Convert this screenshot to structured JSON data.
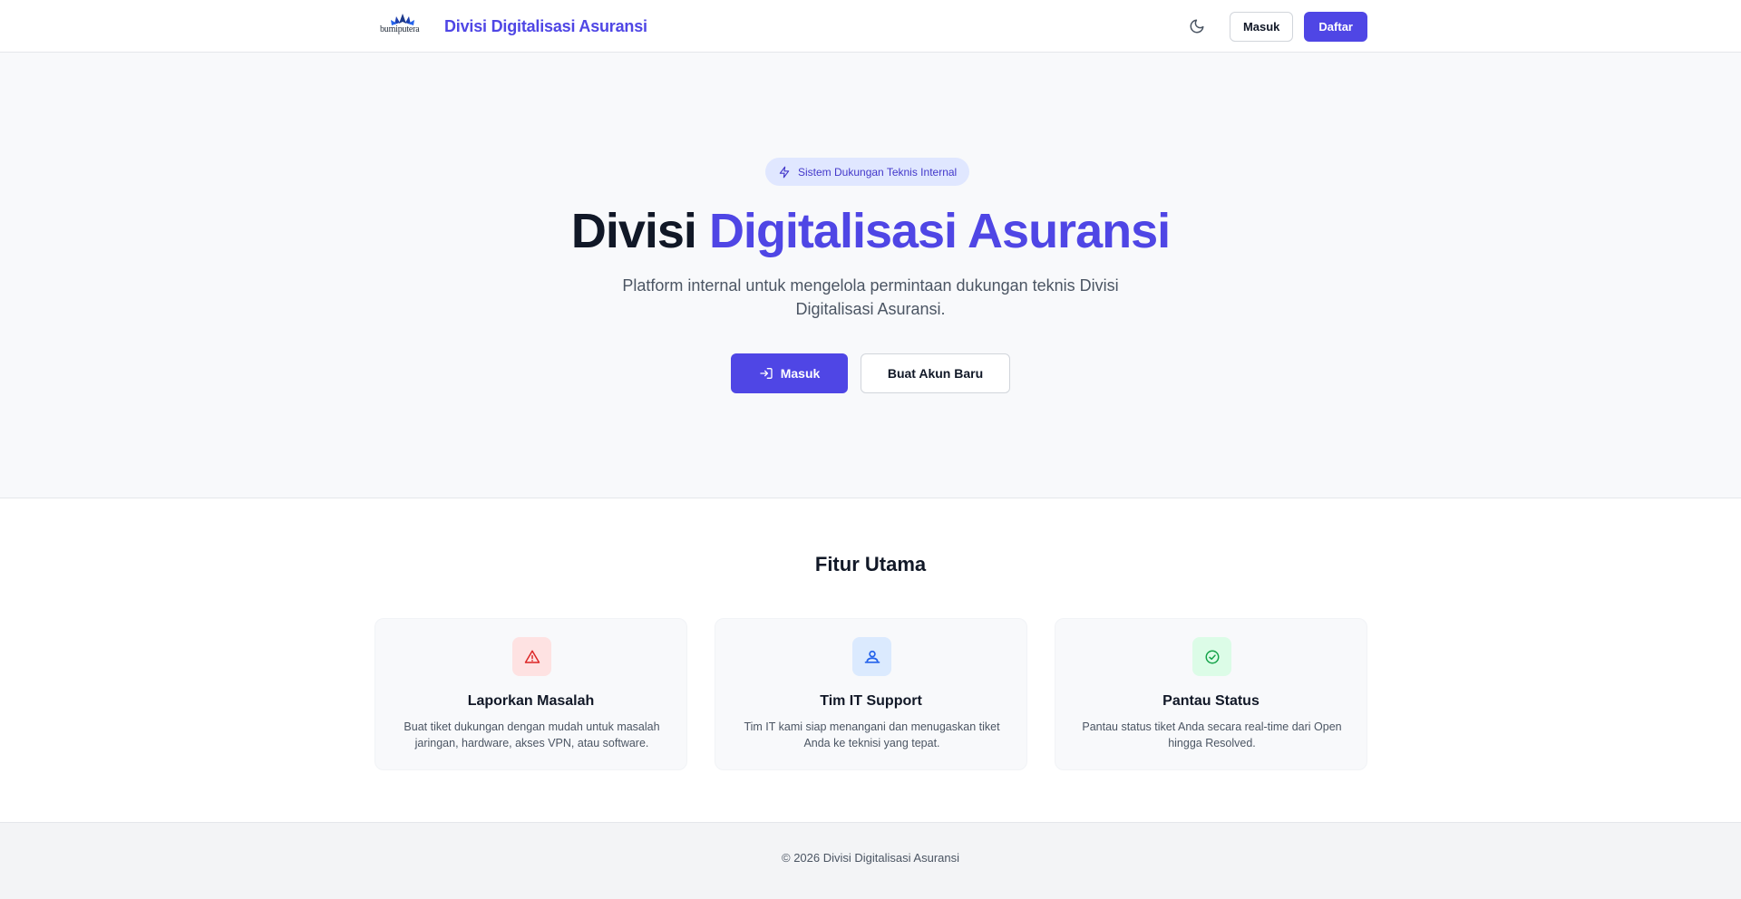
{
  "colors": {
    "accent": "#4f46e5",
    "hero_bg": "#f8f9fb",
    "footer_bg": "#f3f4f6",
    "danger_bg": "#fee2e2",
    "danger": "#dc2626",
    "info_bg": "#dbeafe",
    "info": "#2563eb",
    "success_bg": "#dcfce7",
    "success": "#16a34a"
  },
  "navbar": {
    "logo_text": "bumiputera",
    "logo_icon": "lotus-logo-icon",
    "brand_title": "Divisi Digitalisasi Asuransi",
    "theme_icon": "moon-icon",
    "login_label": "Masuk",
    "register_label": "Daftar"
  },
  "hero": {
    "badge_icon": "lightning-icon",
    "badge_text": "Sistem Dukungan Teknis Internal",
    "title_plain": "Divisi",
    "title_accent": "Digitalisasi Asuransi",
    "description": "Platform internal untuk mengelola permintaan dukungan teknis Divisi Digitalisasi Asuransi.",
    "login_icon": "login-icon",
    "login_label": "Masuk",
    "register_label": "Buat Akun Baru"
  },
  "features": {
    "title": "Fitur Utama",
    "cards": [
      {
        "icon": "warning-triangle-icon",
        "title": "Laporkan Masalah",
        "description": "Buat tiket dukungan dengan mudah untuk masalah jaringan, hardware, akses VPN, atau software."
      },
      {
        "icon": "user-team-icon",
        "title": "Tim IT Support",
        "description": "Tim IT kami siap menangani dan menugaskan tiket Anda ke teknisi yang tepat."
      },
      {
        "icon": "check-circle-icon",
        "title": "Pantau Status",
        "description": "Pantau status tiket Anda secara real-time dari Open hingga Resolved."
      }
    ]
  },
  "footer": {
    "copyright": "© 2026 Divisi Digitalisasi Asuransi"
  }
}
